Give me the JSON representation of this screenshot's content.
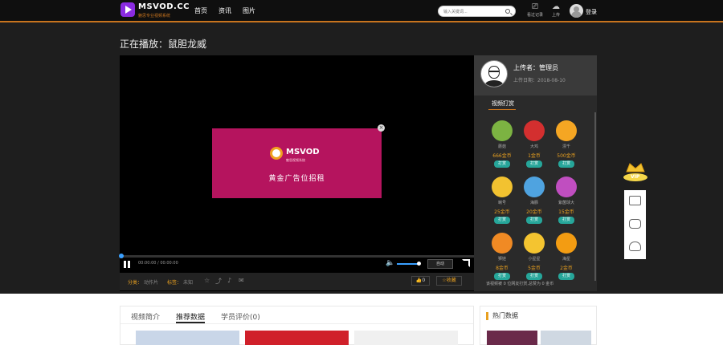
{
  "header": {
    "logo_text": "MSVOD.CC",
    "logo_sub": "魅思专业视频系统",
    "nav": [
      "首页",
      "资讯",
      "图片"
    ],
    "search_placeholder": "输入关键词...",
    "icons": [
      {
        "icon": "history-icon",
        "label": "看过记录"
      },
      {
        "icon": "upload-icon",
        "label": "上传"
      }
    ],
    "login_label": "登录"
  },
  "now_playing": "正在播放：鼠胆龙威",
  "player": {
    "time": "00:00:00 / 00:00:00",
    "autoplay_label": "自动",
    "progress_fraction": 0.0,
    "volume_fraction": 0.8,
    "ad": {
      "brand": "MSVOD",
      "subtitle": "魅思视频系统",
      "text": "黄金广告位招租"
    }
  },
  "meta": {
    "category_label": "分类：",
    "category_value": "动作片",
    "tags_label": "标签：",
    "tags_value": "未知",
    "like_count": "0",
    "favorite_label": "收藏"
  },
  "side": {
    "uploader": "上传者：管理员",
    "upload_date": "上传日期：2018-08-10",
    "tip_title": "视频打赏",
    "gifts": [
      {
        "name": "蘑菇",
        "price": "666金币",
        "button": "打赏",
        "icon": "green-monster-icon",
        "color": "#7cb342"
      },
      {
        "name": "大鸡",
        "price": "1金币",
        "button": "打赏",
        "icon": "red-bird-icon",
        "color": "#d32f2f"
      },
      {
        "name": "漂千",
        "price": "500金币",
        "button": "打赏",
        "icon": "orange-fox-icon",
        "color": "#f5a623"
      },
      {
        "name": "喇号",
        "price": "25金币",
        "button": "打赏",
        "icon": "yellow-seahorse-icon",
        "color": "#f2c230"
      },
      {
        "name": "海豚",
        "price": "20金币",
        "button": "打赏",
        "icon": "blue-dolphin-icon",
        "color": "#4fa3e0"
      },
      {
        "name": "紫菌球大",
        "price": "15金币",
        "button": "打赏",
        "icon": "purple-brain-icon",
        "color": "#c04ec0"
      },
      {
        "name": "狮娃",
        "price": "8金币",
        "button": "打赏",
        "icon": "lion-icon",
        "color": "#f08a24"
      },
      {
        "name": "小星星",
        "price": "5金币",
        "button": "打赏",
        "icon": "star-face-icon",
        "color": "#f4c430"
      },
      {
        "name": "海星",
        "price": "2金币",
        "button": "打赏",
        "icon": "starfish-icon",
        "color": "#f39c12"
      }
    ],
    "footer": "该视频被 0 位网友打赏,总赞为 0 金币"
  },
  "lower": {
    "tabs": [
      "视频简介",
      "推荐数据",
      "学员评价(0)"
    ],
    "active_tab": 1,
    "hot_title": "热门数据"
  },
  "floatbar": {
    "vip_label": "VIP"
  }
}
